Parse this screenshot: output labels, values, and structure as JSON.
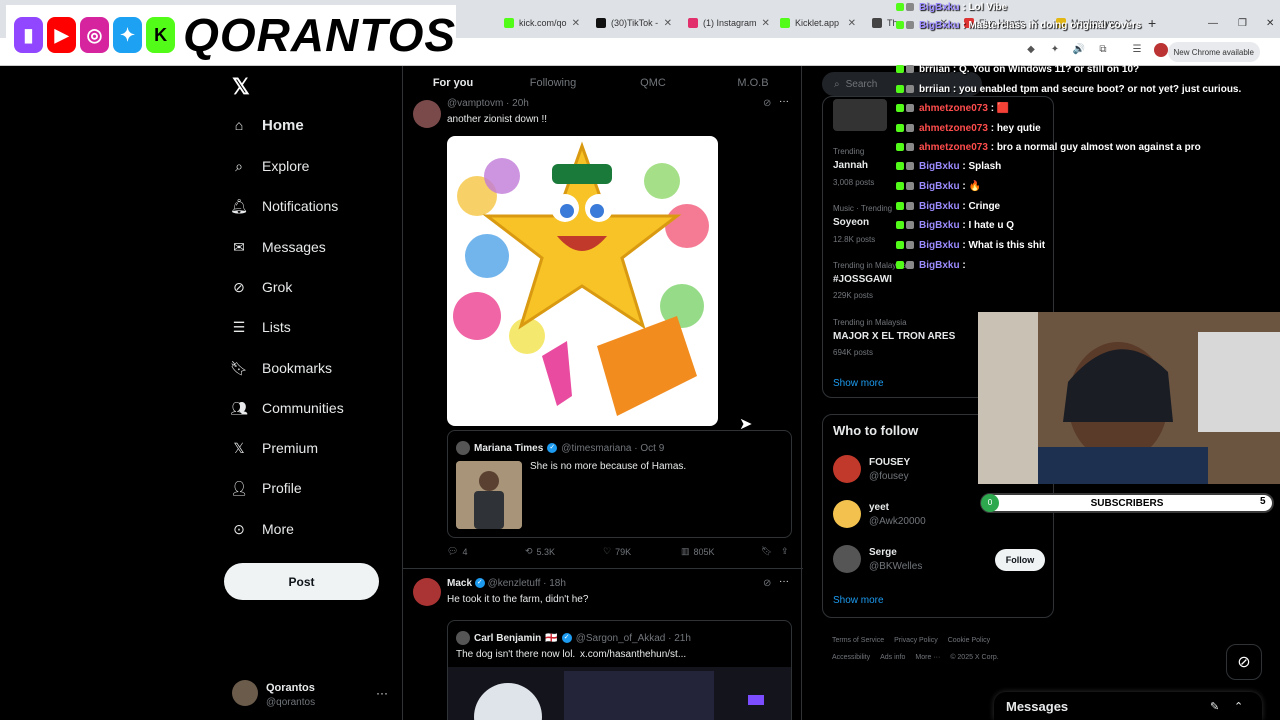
{
  "browser": {
    "tabs": [
      {
        "label": "kick.com/qo",
        "color": "#53fc18"
      },
      {
        "label": "(30)TikTok -",
        "color": "#111111"
      },
      {
        "label": "(1) Instagram",
        "color": "#e1306c"
      },
      {
        "label": "Kicklet.app",
        "color": "#53fc18"
      },
      {
        "label": "The",
        "color": "#444444"
      },
      {
        "label": "Five Hearts",
        "color": "#d33"
      },
      {
        "label": "Monkeytype",
        "color": "#e2b714"
      }
    ],
    "new_tab_icon": "plus-icon",
    "new_chrome": "New Chrome available"
  },
  "stream_logo": {
    "text": "QORANTOS",
    "badges": [
      {
        "icon": "twitch-icon",
        "color": "#9146ff"
      },
      {
        "icon": "youtube-icon",
        "color": "#ff0000"
      },
      {
        "icon": "instagram-icon",
        "color": "#d6249f"
      },
      {
        "icon": "twitter-icon",
        "color": "#1da1f2"
      },
      {
        "icon": "kick-icon",
        "color": "#53fc18"
      }
    ]
  },
  "nav": {
    "items": [
      {
        "label": "Home",
        "icon": "home-icon"
      },
      {
        "label": "Explore",
        "icon": "search-icon"
      },
      {
        "label": "Notifications",
        "icon": "bell-icon"
      },
      {
        "label": "Messages",
        "icon": "envelope-icon"
      },
      {
        "label": "Grok",
        "icon": "grok-icon"
      },
      {
        "label": "Lists",
        "icon": "list-icon"
      },
      {
        "label": "Bookmarks",
        "icon": "bookmark-icon"
      },
      {
        "label": "Communities",
        "icon": "people-icon"
      },
      {
        "label": "Premium",
        "icon": "x-icon"
      },
      {
        "label": "Profile",
        "icon": "person-icon"
      },
      {
        "label": "More",
        "icon": "more-circle-icon"
      }
    ],
    "post_label": "Post"
  },
  "account": {
    "name": "Qorantos",
    "handle": "@qorantos"
  },
  "feed": {
    "tabs": [
      "For you",
      "Following",
      "QMC",
      "M.O.B"
    ],
    "tweet1": {
      "handle": "@vamptovm · 20h",
      "text": "another zionist down !!",
      "quote": {
        "name": "Mariana Times",
        "handle": "@timesmariana · Oct 9",
        "text": "She is no more because of Hamas."
      },
      "actions": {
        "replies": "4",
        "reposts": "5.3K",
        "likes": "79K",
        "views": "805K"
      }
    },
    "tweet2": {
      "name": "Mack",
      "handle": "@kenzletuff · 18h",
      "text": "He took it to the farm, didn't he?",
      "quote": {
        "name": "Carl Benjamin",
        "flag": "🏴󠁧󠁢󠁥󠁮󠁧󠁿",
        "handle": "@Sargon_of_Akkad · 21h",
        "text": "The dog isn't there now lol.",
        "link": "x.com/hasanthehun/st..."
      }
    }
  },
  "right": {
    "search_placeholder": "Search",
    "trends": [
      {
        "context": "Trending",
        "name": "Jannah",
        "count": "3,008 posts"
      },
      {
        "context": "Music · Trending",
        "name": "Soyeon",
        "count": "12.8K posts"
      },
      {
        "context": "Trending in Malaysia",
        "name": "#JOSSGAWI",
        "count": "229K posts"
      },
      {
        "context": "Trending in Malaysia",
        "name": "MAJOR X EL TRON ARES",
        "count": "694K posts"
      }
    ],
    "show_more": "Show more",
    "who_to_follow": "Who to follow",
    "follow_suggestions": [
      {
        "name": "FOUSEY",
        "handle": "@fousey",
        "button": "Follow"
      },
      {
        "name": "yeet",
        "handle": "@Awk20000",
        "button": "Follow"
      },
      {
        "name": "Serge",
        "handle": "@BKWelles",
        "button": "Follow"
      }
    ],
    "footer": [
      "Terms of Service",
      "Privacy Policy",
      "Cookie Policy",
      "Accessibility",
      "Ads info",
      "More ···",
      "© 2025 X Corp."
    ]
  },
  "chat": [
    {
      "user": "BigBxku",
      "msg": "Lol Vibe",
      "color": "#9b8cff"
    },
    {
      "user": "BigBxku",
      "msg": "Masterclass in doing original covers",
      "color": "#9b8cff"
    },
    {
      "user": "brriian",
      "msg": "Q. You on Windows 11? or still on 10?",
      "color": "#ffffff"
    },
    {
      "user": "brriian",
      "msg": "you enabled tpm and secure boot? or not yet? just curious.",
      "color": "#ffffff"
    },
    {
      "user": "ahmetzone073",
      "msg": "🟥",
      "color": "#ff4d4d"
    },
    {
      "user": "ahmetzone073",
      "msg": "hey qutie",
      "color": "#ff4d4d"
    },
    {
      "user": "ahmetzone073",
      "msg": "bro a normal guy almost won against a pro",
      "color": "#ff4d4d"
    },
    {
      "user": "BigBxku",
      "msg": "Splash",
      "color": "#9b8cff"
    },
    {
      "user": "BigBxku",
      "msg": "🔥",
      "color": "#9b8cff"
    },
    {
      "user": "BigBxku",
      "msg": "Cringe",
      "color": "#9b8cff"
    },
    {
      "user": "BigBxku",
      "msg": "I hate u Q",
      "color": "#9b8cff"
    },
    {
      "user": "BigBxku",
      "msg": "What is this shit",
      "color": "#9b8cff"
    },
    {
      "user": "BigBxku",
      "msg": "",
      "color": "#9b8cff"
    }
  ],
  "subscribers": {
    "label": "SUBSCRIBERS",
    "current": "0",
    "goal": "5",
    "progress": 0
  },
  "messages_drawer": {
    "title": "Messages"
  }
}
